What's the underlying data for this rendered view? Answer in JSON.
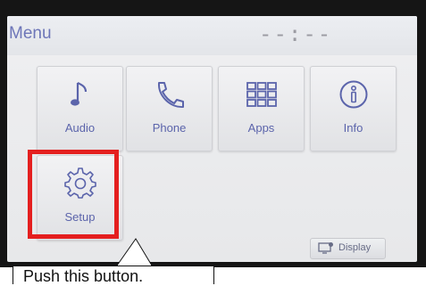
{
  "header": {
    "title": "Menu",
    "clock": "--:--"
  },
  "tiles": [
    {
      "label": "Audio",
      "icon": "music-note-icon"
    },
    {
      "label": "Phone",
      "icon": "phone-icon"
    },
    {
      "label": "Apps",
      "icon": "apps-grid-icon"
    },
    {
      "label": "Info",
      "icon": "info-icon"
    },
    {
      "label": "Setup",
      "icon": "gear-icon"
    }
  ],
  "display_button": {
    "label": "Display",
    "icon": "display-icon"
  },
  "callout": {
    "text": "Push this button."
  },
  "colors": {
    "accent": "#5b64ab",
    "highlight": "#e41f1f",
    "bezel": "#151515"
  }
}
